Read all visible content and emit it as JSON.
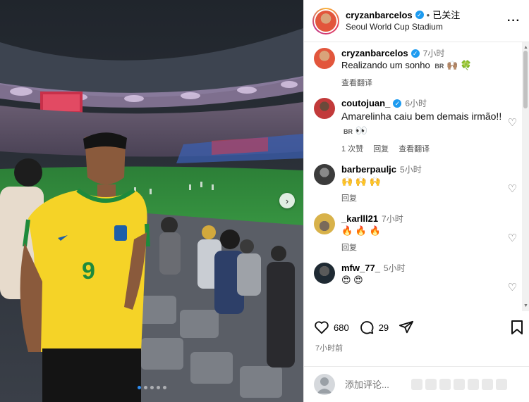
{
  "post": {
    "username": "cryzanbarcelos",
    "follow_status": "已关注",
    "location": "Seoul World Cup Stadium",
    "more_icon": "more-dots-icon"
  },
  "comments": [
    {
      "username": "cryzanbarcelos",
      "time": "7小时",
      "text": "Realizando um sonho",
      "flag": "BR",
      "emoji": "🙌🏽 🍀",
      "translate": "查看翻译",
      "verified": true
    },
    {
      "username": "coutojuan_",
      "time": "6小时",
      "text": "Amarelinha caiu bem demais irmão!!",
      "flag": "BR",
      "emoji": "👀",
      "likes": "1 次赞",
      "reply": "回复",
      "translate": "查看翻译",
      "verified": true
    },
    {
      "username": "barberpauljc",
      "time": "5小时",
      "text": "🙌 🙌 🙌",
      "reply": "回复"
    },
    {
      "username": "_karlll21",
      "time": "7小时",
      "text": "🔥 🔥 🔥",
      "reply": "回复"
    },
    {
      "username": "mfw_77_",
      "time": "5小时",
      "text": "😍 😍"
    }
  ],
  "actions": {
    "likes": "680",
    "comments": "29",
    "post_time": "7小时前"
  },
  "comment_input": {
    "placeholder": "添加评论..."
  },
  "carousel": {
    "slide_count": 5,
    "active_slide": 1
  },
  "colors": {
    "accent": "#1d9bf0",
    "brazil_yellow": "#f5d327",
    "brazil_green": "#1e8a3c",
    "pitch": "#2f8a3a"
  }
}
